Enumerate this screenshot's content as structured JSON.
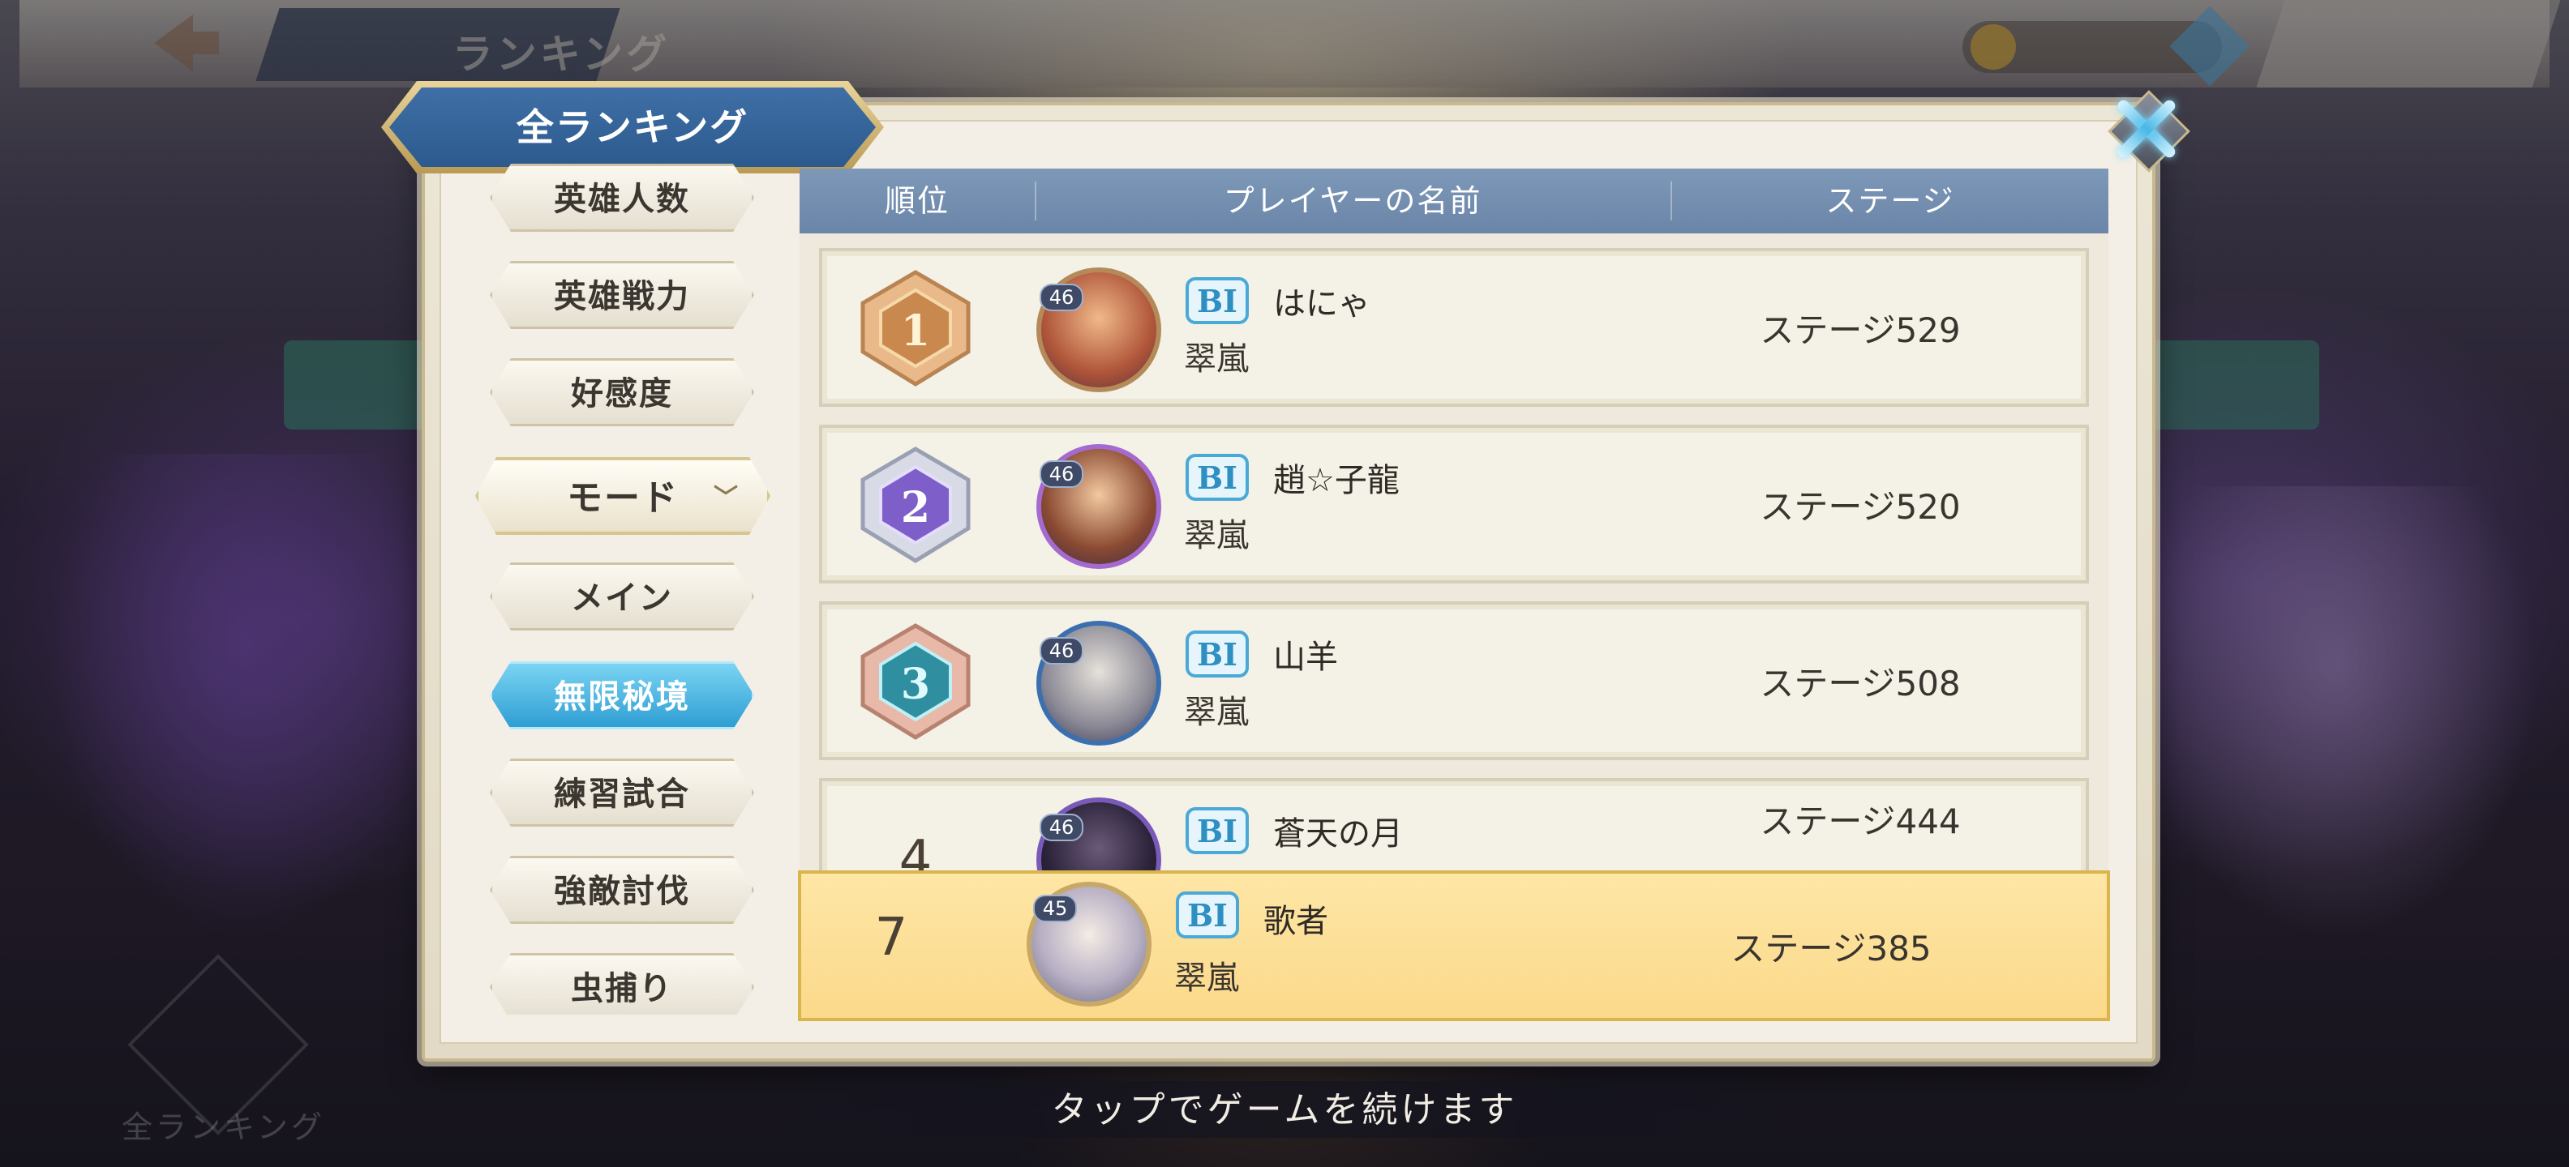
{
  "background": {
    "screen_title": "ランキング",
    "bottom_nav_label": "全ランキング"
  },
  "panel": {
    "title": "全ランキング"
  },
  "sidebar": {
    "items": [
      {
        "label": "英雄人数"
      },
      {
        "label": "英雄戦力"
      },
      {
        "label": "好感度"
      },
      {
        "label": "モード",
        "type": "dropdown-header"
      },
      {
        "label": "メイン"
      },
      {
        "label": "無限秘境",
        "active": true
      },
      {
        "label": "練習試合"
      },
      {
        "label": "強敵討伐"
      },
      {
        "label": "虫捕り"
      }
    ]
  },
  "table": {
    "headers": [
      "順位",
      "プレイヤーの名前",
      "ステージ"
    ],
    "rows": [
      {
        "rank": "1",
        "level": "46",
        "rank_icon": "BI",
        "name": "はにゃ",
        "guild": "翠嵐",
        "stage": "ステージ529"
      },
      {
        "rank": "2",
        "level": "46",
        "rank_icon": "BI",
        "name": "趙☆子龍",
        "guild": "翠嵐",
        "stage": "ステージ520"
      },
      {
        "rank": "3",
        "level": "46",
        "rank_icon": "BI",
        "name": "山羊",
        "guild": "翠嵐",
        "stage": "ステージ508"
      },
      {
        "rank": "4",
        "level": "46",
        "rank_icon": "BI",
        "name": "蒼天の月",
        "guild": "",
        "stage": "ステージ444"
      }
    ],
    "my_row": {
      "rank": "7",
      "level": "45",
      "rank_icon": "BI",
      "name": "歌者",
      "guild": "翠嵐",
      "stage": "ステージ385"
    }
  },
  "footer": {
    "hint": "タップでゲームを続けます"
  },
  "colors": {
    "header_blue": "#6a85a8",
    "active_tab": "#2f9ed3",
    "my_row_highlight": "#fbd98a",
    "gold_badge": "#d8a25a",
    "silver_badge": "#8a6ad0",
    "bronze_badge": "#3fb3c2"
  }
}
